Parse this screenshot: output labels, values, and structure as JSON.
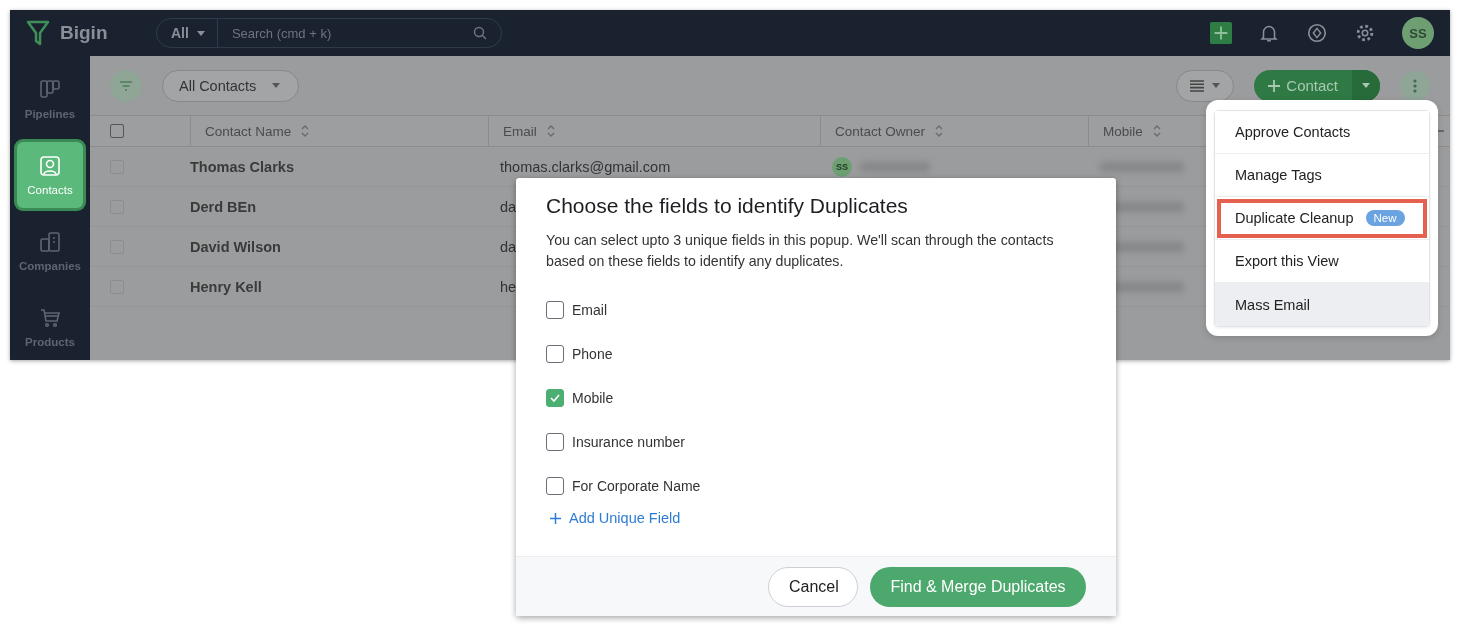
{
  "app": {
    "logo": "Bigin",
    "search": {
      "scope": "All",
      "placeholder": "Search (cmd + k)"
    },
    "avatar": "SS"
  },
  "sidebar": [
    {
      "label": "Pipelines",
      "selected": false
    },
    {
      "label": "Contacts",
      "selected": true
    },
    {
      "label": "Companies",
      "selected": false
    },
    {
      "label": "Products",
      "selected": false
    }
  ],
  "toolbar": {
    "view": "All Contacts",
    "add_button": "Contact"
  },
  "table": {
    "select_all_checked": false,
    "columns": [
      "Contact Name",
      "Email",
      "Contact Owner",
      "Mobile"
    ],
    "rows": [
      {
        "checked": false,
        "name": "Thomas Clarks",
        "email": "thomas.clarks@gmail.com",
        "owner_initials": "SS"
      },
      {
        "checked": false,
        "name": "Derd BEn",
        "email": "da"
      },
      {
        "checked": false,
        "name": "David Wilson",
        "email": "da"
      },
      {
        "checked": false,
        "name": "Henry Kell",
        "email": "he"
      }
    ]
  },
  "menu": {
    "items": [
      {
        "label": "Approve Contacts",
        "highlighted": false,
        "hovered": false
      },
      {
        "label": "Manage Tags",
        "highlighted": false,
        "hovered": false
      },
      {
        "label": "Duplicate Cleanup",
        "badge": "New",
        "highlighted": true,
        "hovered": false
      },
      {
        "label": "Export this View",
        "highlighted": false,
        "hovered": false
      },
      {
        "label": "Mass Email",
        "highlighted": false,
        "hovered": true
      }
    ]
  },
  "dialog": {
    "title": "Choose the fields to identify Duplicates",
    "description": "You can select upto 3 unique fields in this popup. We'll scan through the contacts based on these fields to identify any duplicates.",
    "fields": [
      {
        "label": "Email",
        "checked": false
      },
      {
        "label": "Phone",
        "checked": false
      },
      {
        "label": "Mobile",
        "checked": true
      },
      {
        "label": "Insurance number",
        "checked": false
      },
      {
        "label": "For Corporate Name",
        "checked": false
      }
    ],
    "add_link": "Add Unique Field",
    "buttons": [
      {
        "label": "Cancel",
        "kind": "secondary"
      },
      {
        "label": "Find & Merge Duplicates",
        "kind": "primary"
      }
    ]
  }
}
